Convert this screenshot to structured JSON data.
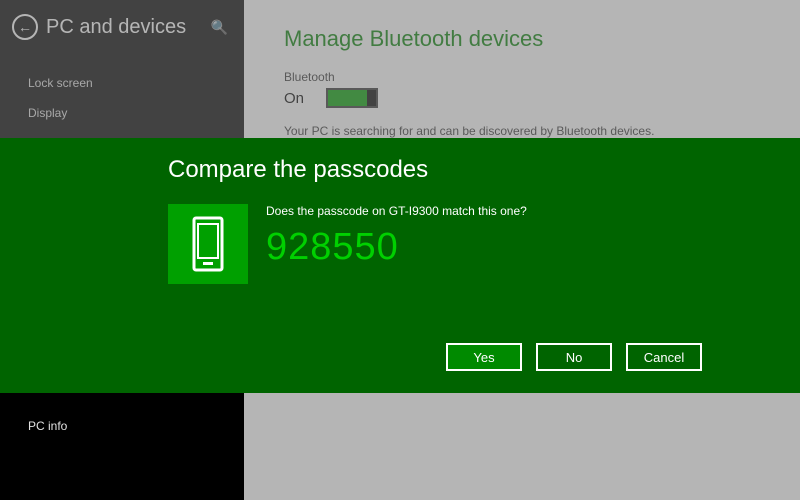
{
  "sidebar": {
    "title": "PC and devices",
    "items": [
      "Lock screen",
      "Display"
    ],
    "bottom_item": "PC info"
  },
  "main": {
    "title": "Manage Bluetooth devices",
    "bt_label": "Bluetooth",
    "toggle_state": "On",
    "search_text": "Your PC is searching for and can be discovered by Bluetooth devices."
  },
  "dialog": {
    "title": "Compare the passcodes",
    "question": "Does the passcode on GT-I9300 match this one?",
    "passcode": "928550",
    "buttons": {
      "yes": "Yes",
      "no": "No",
      "cancel": "Cancel"
    }
  }
}
